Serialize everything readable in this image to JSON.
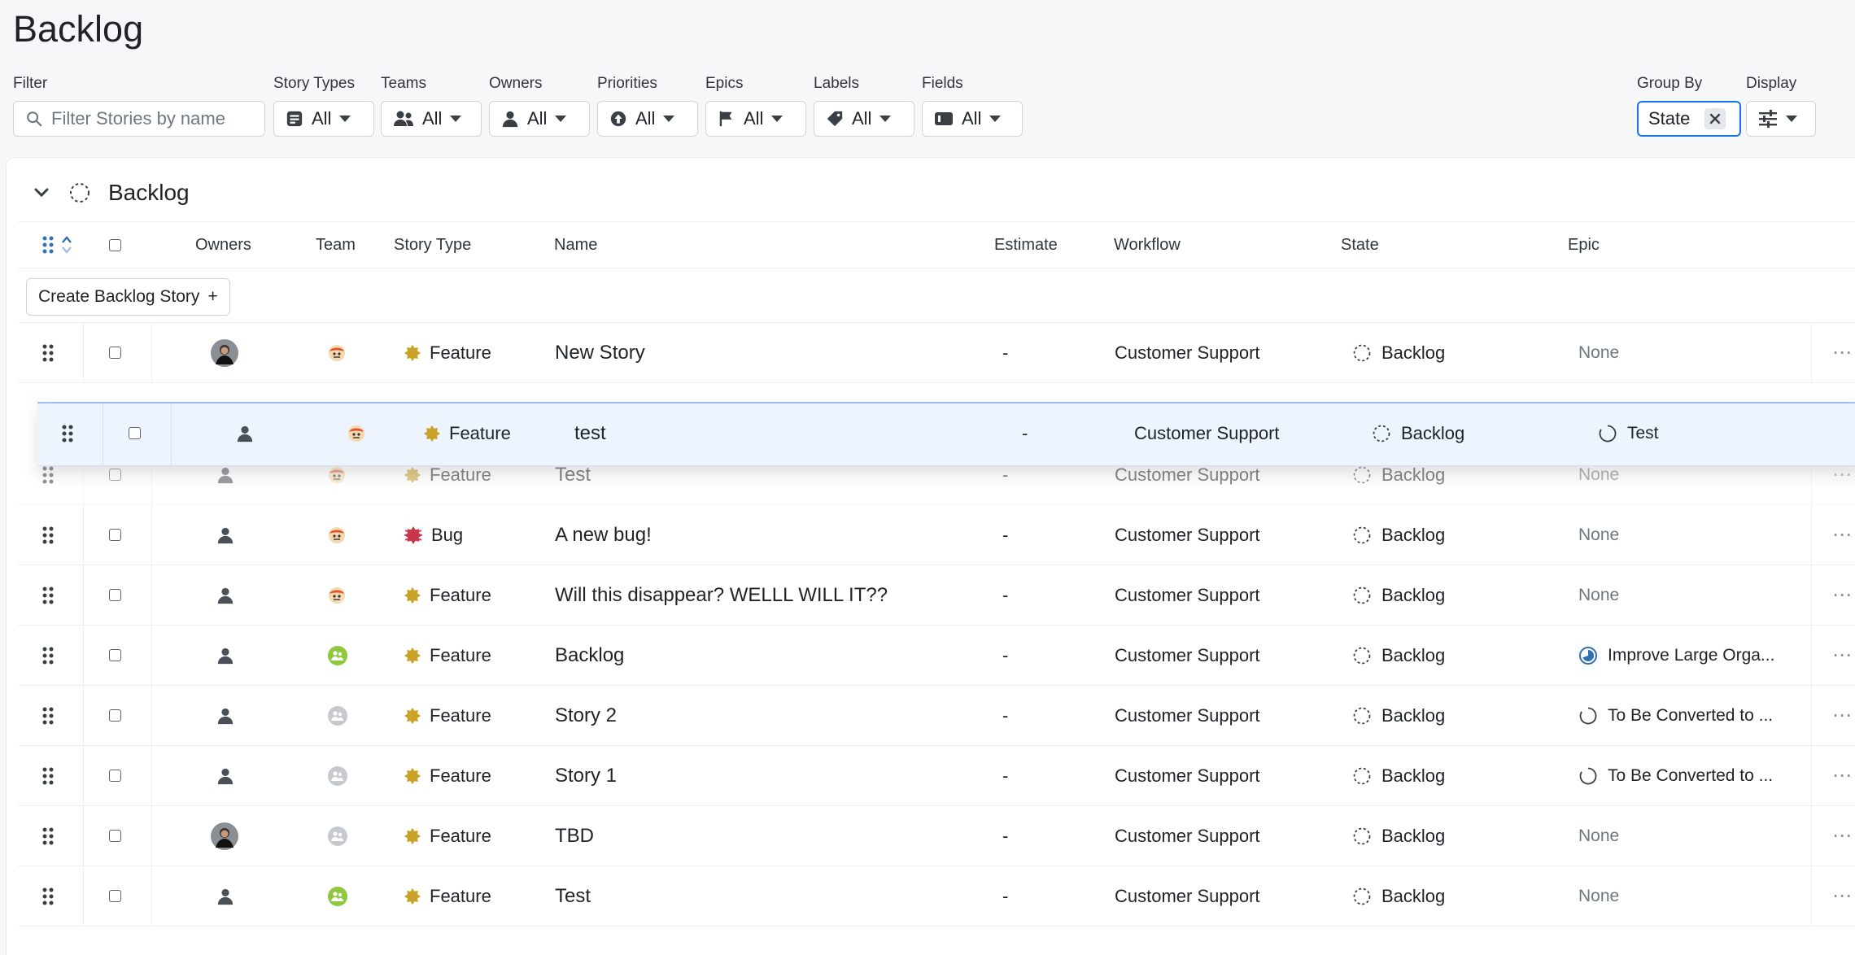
{
  "page": {
    "title": "Backlog"
  },
  "filters": {
    "filter_label": "Filter",
    "search_placeholder": "Filter Stories by name",
    "story_types": {
      "label": "Story Types",
      "value": "All"
    },
    "teams": {
      "label": "Teams",
      "value": "All"
    },
    "owners": {
      "label": "Owners",
      "value": "All"
    },
    "priorities": {
      "label": "Priorities",
      "value": "All"
    },
    "epics": {
      "label": "Epics",
      "value": "All"
    },
    "labels": {
      "label": "Labels",
      "value": "All"
    },
    "fields": {
      "label": "Fields",
      "value": "All"
    },
    "group_by": {
      "label": "Group By",
      "value": "State"
    },
    "display": {
      "label": "Display"
    }
  },
  "group": {
    "title": "Backlog"
  },
  "columns": {
    "owners": "Owners",
    "team": "Team",
    "story_type": "Story Type",
    "name": "Name",
    "estimate": "Estimate",
    "workflow": "Workflow",
    "state": "State",
    "epic": "Epic"
  },
  "create_button": {
    "label": "Create Backlog Story",
    "icon": "+"
  },
  "dragged_row": {
    "story_type": "Feature",
    "name": "test",
    "estimate": "-",
    "workflow": "Customer Support",
    "state": "Backlog",
    "epic": "Test"
  },
  "rows": [
    {
      "owner": "photo",
      "team": "mascot",
      "story_type": "Feature",
      "name": "New Story",
      "estimate": "-",
      "workflow": "Customer Support",
      "state": "Backlog",
      "epic": "None",
      "epic_state": "none"
    },
    {
      "owner": "generic",
      "team": "mascot",
      "story_type": "Feature",
      "name": "Test",
      "estimate": "-",
      "workflow": "Customer Support",
      "state": "Backlog",
      "epic": "None",
      "epic_state": "none"
    },
    {
      "owner": "generic",
      "team": "mascot",
      "story_type": "Bug",
      "name": "A new bug!",
      "estimate": "-",
      "workflow": "Customer Support",
      "state": "Backlog",
      "epic": "None",
      "epic_state": "none"
    },
    {
      "owner": "generic",
      "team": "mascot",
      "story_type": "Feature",
      "name": "Will this disappear? WELLL WILL IT??",
      "estimate": "-",
      "workflow": "Customer Support",
      "state": "Backlog",
      "epic": "None",
      "epic_state": "none"
    },
    {
      "owner": "generic",
      "team": "green",
      "story_type": "Feature",
      "name": "Backlog",
      "estimate": "-",
      "workflow": "Customer Support",
      "state": "Backlog",
      "epic": "Improve Large Orga...",
      "epic_state": "in-progress"
    },
    {
      "owner": "generic",
      "team": "gray",
      "story_type": "Feature",
      "name": "Story 2",
      "estimate": "-",
      "workflow": "Customer Support",
      "state": "Backlog",
      "epic": "To Be Converted to ...",
      "epic_state": "todo"
    },
    {
      "owner": "generic",
      "team": "gray",
      "story_type": "Feature",
      "name": "Story 1",
      "estimate": "-",
      "workflow": "Customer Support",
      "state": "Backlog",
      "epic": "To Be Converted to ...",
      "epic_state": "todo"
    },
    {
      "owner": "photo",
      "team": "gray",
      "story_type": "Feature",
      "name": "TBD",
      "estimate": "-",
      "workflow": "Customer Support",
      "state": "Backlog",
      "epic": "None",
      "epic_state": "none"
    },
    {
      "owner": "generic",
      "team": "green",
      "story_type": "Feature",
      "name": "Test",
      "estimate": "-",
      "workflow": "Customer Support",
      "state": "Backlog",
      "epic": "None",
      "epic_state": "none"
    }
  ],
  "colors": {
    "feature": "#c9a227",
    "bug": "#c8344a",
    "epic_progress": "#2f6fb3",
    "green_team": "#8fc73e",
    "gray_team": "#c6c9cd",
    "focus": "#1a73e8"
  }
}
